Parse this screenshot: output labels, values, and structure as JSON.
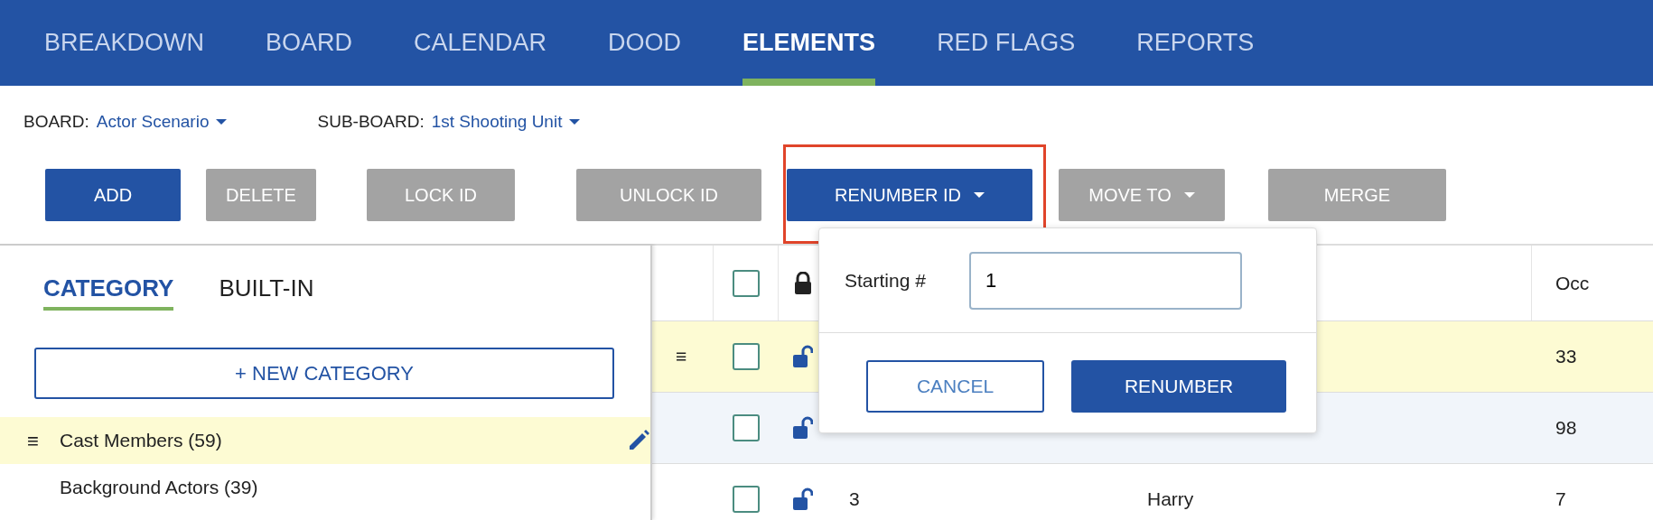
{
  "nav_tabs": [
    {
      "label": "BREAKDOWN",
      "selected": false
    },
    {
      "label": "BOARD",
      "selected": false
    },
    {
      "label": "CALENDAR",
      "selected": false
    },
    {
      "label": "DOOD",
      "selected": false
    },
    {
      "label": "ELEMENTS",
      "selected": true
    },
    {
      "label": "RED FLAGS",
      "selected": false
    },
    {
      "label": "REPORTS",
      "selected": false
    }
  ],
  "selectors": [
    {
      "label": "BOARD:",
      "value": "Actor Scenario"
    },
    {
      "label": "SUB-BOARD:",
      "value": "1st Shooting Unit"
    }
  ],
  "toolbar": [
    {
      "label": "ADD",
      "kind": "primary",
      "dropdown": false,
      "highlighted": false
    },
    {
      "label": "DELETE",
      "kind": "secondary",
      "dropdown": false,
      "highlighted": false
    },
    {
      "label": "LOCK ID",
      "kind": "secondary",
      "dropdown": false,
      "highlighted": false
    },
    {
      "label": "UNLOCK ID",
      "kind": "secondary",
      "dropdown": false,
      "highlighted": false
    },
    {
      "label": "RENUMBER ID",
      "kind": "primary",
      "dropdown": true,
      "highlighted": true
    },
    {
      "label": "MOVE TO",
      "kind": "secondary",
      "dropdown": true,
      "highlighted": false
    },
    {
      "label": "MERGE",
      "kind": "secondary",
      "dropdown": false,
      "highlighted": false
    }
  ],
  "sidebar": {
    "tabs": [
      {
        "label": "CATEGORY",
        "selected": true
      },
      {
        "label": "BUILT-IN",
        "selected": false
      }
    ],
    "new_button": "+ NEW CATEGORY",
    "items": [
      {
        "label": "Cast Members (59)",
        "handle": "≡",
        "selected": true
      },
      {
        "label": "Background Actors (39)",
        "selected": false
      }
    ]
  },
  "table": {
    "header": {
      "checked": false,
      "locked": true,
      "occ": "Occ"
    },
    "rows": [
      {
        "handle": "≡",
        "selected": true,
        "checked": false,
        "locked": false,
        "occ": "33"
      },
      {
        "selected": false,
        "checked": false,
        "locked": false,
        "occ": "98"
      },
      {
        "selected": false,
        "checked": false,
        "locked": false,
        "id": "3",
        "name": "Harry",
        "occ": "7"
      }
    ]
  },
  "renumber_popover": {
    "label": "Starting #",
    "value": "1",
    "buttons": [
      {
        "label": "CANCEL",
        "kind": "outline"
      },
      {
        "label": "RENUMBER",
        "kind": "primary"
      }
    ]
  }
}
